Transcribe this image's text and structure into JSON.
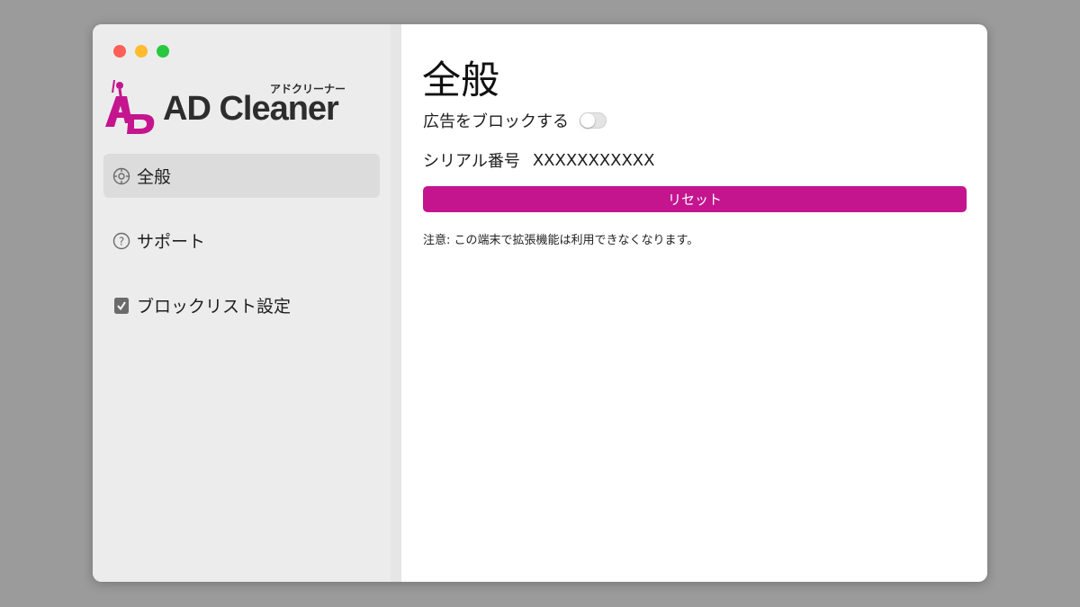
{
  "app": {
    "logo_text": "AD Cleaner",
    "logo_kana": "アドクリーナー",
    "brand_color": "#c4158f"
  },
  "window_controls": {
    "close_icon": "red-circle",
    "minimize_icon": "yellow-circle",
    "zoom_icon": "green-circle"
  },
  "sidebar": {
    "items": [
      {
        "label": "全般",
        "icon": "gear-icon",
        "active": true
      },
      {
        "label": "サポート",
        "icon": "question-circle-icon",
        "active": false
      },
      {
        "label": "ブロックリスト設定",
        "icon": "checkbox-icon",
        "active": false
      }
    ]
  },
  "main": {
    "title": "全般",
    "block_ads_label": "広告をブロックする",
    "block_ads_enabled": false,
    "serial_label": "シリアル番号",
    "serial_value": "XXXXXXXXXXX",
    "reset_label": "リセット",
    "note": "注意: この端末で拡張機能は利用できなくなります。"
  }
}
